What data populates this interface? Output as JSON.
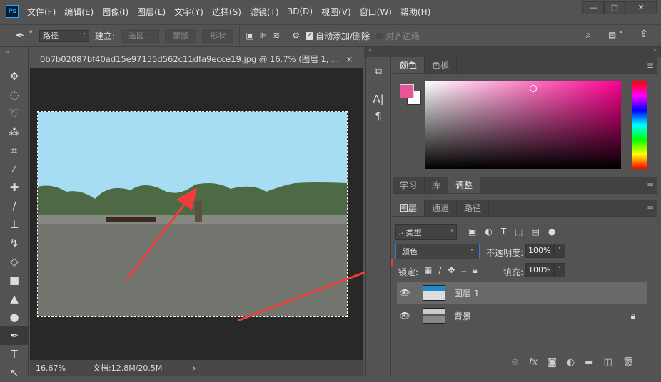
{
  "app": {
    "logo": "Ps"
  },
  "menu": [
    "文件(F)",
    "编辑(E)",
    "图像(I)",
    "图层(L)",
    "文字(Y)",
    "选择(S)",
    "滤镜(T)",
    "3D(D)",
    "视图(V)",
    "窗口(W)",
    "帮助(H)"
  ],
  "options": {
    "mode": "路径",
    "build_label": "建立:",
    "selection_btn": "选区...",
    "mask_btn": "蒙版",
    "shape_btn": "形状",
    "auto_add_delete": "自动添加/删除",
    "align_edges": "对齐边缘"
  },
  "document": {
    "tab_title": "0b7b02087bf40ad15e97155d562c11dfa9ecce19.jpg @ 16.7% (图层 1, ...",
    "zoom": "16.67%",
    "doc_size": "文档:12.8M/20.5M"
  },
  "color_panel": {
    "tabs": [
      "颜色",
      "色板"
    ],
    "foreground": "#e8559a",
    "background": "#ffffff",
    "hue": "#ff0090"
  },
  "adjust_panel": {
    "tabs": [
      "学习",
      "库",
      "调整"
    ]
  },
  "layers_panel": {
    "tabs": [
      "图层",
      "通道",
      "路径"
    ],
    "filter": "类型",
    "blend_mode": "颜色",
    "opacity_label": "不透明度:",
    "opacity": "100%",
    "lock_label": "锁定:",
    "fill_label": "填充:",
    "fill": "100%",
    "layers": [
      {
        "name": "图层 1",
        "selected": true
      },
      {
        "name": "背景",
        "locked": true
      }
    ]
  },
  "annotation_color": "#f03c3c"
}
